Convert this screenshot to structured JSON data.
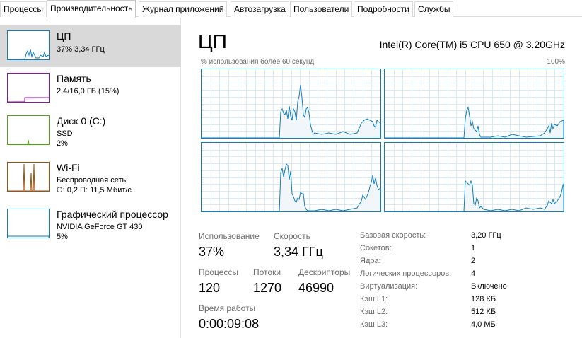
{
  "tabs": [
    {
      "label": "Процессы"
    },
    {
      "label": "Производительность"
    },
    {
      "label": "Журнал приложений"
    },
    {
      "label": "Автозагрузка"
    },
    {
      "label": "Пользователи"
    },
    {
      "label": "Подробности"
    },
    {
      "label": "Службы"
    }
  ],
  "active_tab": "Производительность",
  "sidebar": {
    "items": [
      {
        "title": "ЦП",
        "line1": "37% 3,34 ГГц",
        "line2": "",
        "color": "#117dbb",
        "selected": true
      },
      {
        "title": "Память",
        "line1": "2,4/16,0 ГБ (15%)",
        "line2": "",
        "color": "#8b12ae",
        "selected": false
      },
      {
        "title": "Диск 0 (C:)",
        "line1": "SSD",
        "line2": "2%",
        "color": "#4da60c",
        "selected": false
      },
      {
        "title": "Wi-Fi",
        "line1": "Беспроводная сеть",
        "line2_send_label": "О:",
        "line2_send": "0,2",
        "line2_recv_label": "П:",
        "line2_recv": "11,5 Мбит/с",
        "color": "#a74f01",
        "selected": false
      },
      {
        "title": "Графический процессор",
        "line1": "NVIDIA GeForce GT 430",
        "line2": "5%",
        "color": "#117dbb",
        "selected": false
      }
    ]
  },
  "main": {
    "title": "ЦП",
    "model": "Intel(R) Core(TM) i5 CPU 650 @ 3.20GHz",
    "util_label": "% использования более 60 секунд",
    "util_max": "100%",
    "graph_color": "#117dbb",
    "graph_fill": "#f1f6fa",
    "grid_color": "#d9eaf4",
    "stats": {
      "usage_label": "Использование",
      "usage_value": "37%",
      "speed_label": "Скорость",
      "speed_value": "3,34 ГГц",
      "processes_label": "Процессы",
      "processes_value": "120",
      "threads_label": "Потоки",
      "threads_value": "1270",
      "handles_label": "Дескрипторы",
      "handles_value": "46990",
      "uptime_label": "Время работы",
      "uptime_value": "0:00:09:08"
    },
    "details": [
      {
        "label": "Базовая скорость:",
        "value": "3,20 ГГц"
      },
      {
        "label": "Сокетов:",
        "value": "1"
      },
      {
        "label": "Ядра:",
        "value": "2"
      },
      {
        "label": "Логических процессоров:",
        "value": "4"
      },
      {
        "label": "Виртуализация:",
        "value": "Включено"
      },
      {
        "label": "Кэш L1:",
        "value": "128 КБ"
      },
      {
        "label": "Кэш L2:",
        "value": "512 КБ"
      },
      {
        "label": "Кэш L3:",
        "value": "4,0 МБ"
      }
    ]
  }
}
